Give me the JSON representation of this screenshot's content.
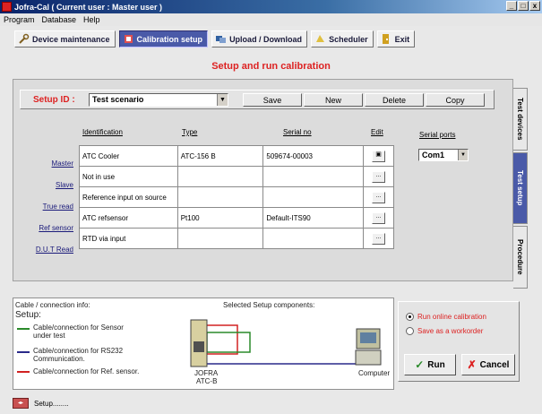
{
  "window": {
    "title": "Jofra-Cal ( Current user : Master user )",
    "minimize": "_",
    "maximize": "□",
    "close": "x"
  },
  "menu": [
    "Program",
    "Database",
    "Help"
  ],
  "toolbar": {
    "device_maintenance": "Device maintenance",
    "calibration_setup": "Calibration setup",
    "upload_download": "Upload / Download",
    "scheduler": "Scheduler",
    "exit": "Exit"
  },
  "heading": "Setup and run calibration",
  "setup": {
    "label": "Setup ID :",
    "value": "Test scenario",
    "save": "Save",
    "new": "New",
    "delete": "Delete",
    "copy": "Copy"
  },
  "grid": {
    "headers": {
      "identification": "Identification",
      "type": "Type",
      "serial_no": "Serial no",
      "edit": "Edit"
    },
    "rows": [
      {
        "label": "Master",
        "identification": "ATC Cooler",
        "type": "ATC-156 B",
        "serial": "509674-00003",
        "edit": "▣"
      },
      {
        "label": "Slave",
        "identification": "Not in use",
        "type": "",
        "serial": "",
        "edit": "..."
      },
      {
        "label": "True read",
        "identification": "Reference input on source",
        "type": "",
        "serial": "",
        "edit": "..."
      },
      {
        "label": "Ref sensor",
        "identification": "ATC refsensor",
        "type": "Pt100",
        "serial": "Default-ITS90",
        "edit": "..."
      },
      {
        "label": "D.U.T Read",
        "identification": "RTD via input",
        "type": "",
        "serial": "",
        "edit": "..."
      }
    ]
  },
  "serial_ports": {
    "label": "Serial ports",
    "value": "Com1"
  },
  "side_tabs": [
    "Test devices",
    "Test setup",
    "Procedure"
  ],
  "bottom": {
    "cable_info": "Cable / connection info:",
    "setup_title": "Setup:",
    "selected_components": "Selected Setup components:",
    "legend": [
      {
        "text": "Cable/connection for Sensor under test",
        "color": "#2a8a2a"
      },
      {
        "text": "Cable/connection for RS232 Communication.",
        "color": "#2a2a8a"
      },
      {
        "text": "Cable/connection for Ref. sensor.",
        "color": "#d22222"
      }
    ],
    "device_label_1": "JOFRA",
    "device_label_2": "ATC-B",
    "computer_label": "Computer"
  },
  "actions": {
    "run_online": "Run online calibration",
    "save_workorder": "Save as a workorder",
    "run": "Run",
    "cancel": "Cancel"
  },
  "status": {
    "text": "Setup........"
  },
  "colors": {
    "accent_red": "#dd2222",
    "active_tab": "#4a5aa8"
  }
}
